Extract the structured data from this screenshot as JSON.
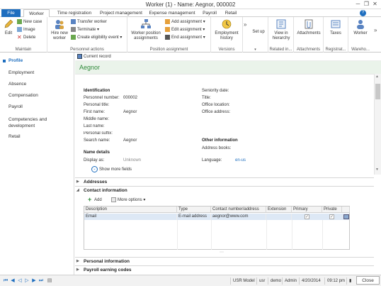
{
  "window": {
    "title": "Worker (1) - Name: Aegnor, 000002",
    "min": "─",
    "restore": "❐",
    "close": "✕"
  },
  "tabs": [
    {
      "label": "File"
    },
    {
      "label": "Worker"
    },
    {
      "label": "Time registration"
    },
    {
      "label": "Project management"
    },
    {
      "label": "Expense management"
    },
    {
      "label": "Payroll"
    },
    {
      "label": "Retail"
    }
  ],
  "ribbon": {
    "maintain": {
      "label": "Maintain",
      "edit": "Edit",
      "new_case": "New case",
      "image": "Image",
      "delete": "Delete"
    },
    "personnel": {
      "label": "Personnel actions",
      "hire": "Hire new worker",
      "transfer": "Transfer worker",
      "terminate": "Terminate",
      "eligibility": "Create eligibility event"
    },
    "position": {
      "label": "Position assignment",
      "worker_position": "Worker position assignments",
      "add": "Add assignment",
      "edit": "Edit assignment",
      "end": "End assignment"
    },
    "versions": {
      "label": "Versions",
      "history": "Employment history"
    },
    "setup": {
      "label": "Set up",
      "more": "»"
    },
    "related": {
      "label": "Related in...",
      "hierarchy": "View in hierarchy"
    },
    "attachments": {
      "label": "Attachments",
      "btn": "Attachments"
    },
    "registration": {
      "label": "Registrat...",
      "taxes": "Taxes"
    },
    "warehouse": {
      "label": "Wareho...",
      "worker": "Worker"
    }
  },
  "nav": {
    "items": [
      "Profile",
      "Employment",
      "Absence",
      "Compensation",
      "Payroll",
      "Competencies and development",
      "Retail"
    ]
  },
  "actionbar": {
    "current_record": "Current record"
  },
  "header": {
    "name": "Aegnor"
  },
  "identification": {
    "title": "Identification",
    "personnel_number_label": "Personnel number:",
    "personnel_number": "000002",
    "personal_title_label": "Personal title:",
    "first_name_label": "First name:",
    "first_name": "Aegnor",
    "middle_name_label": "Middle name:",
    "last_name_label": "Last name:",
    "suffix_label": "Personal suffix:",
    "search_name_label": "Search name:",
    "search_name": "Aegnor"
  },
  "right_col": {
    "seniority_label": "Seniority date:",
    "title_label": "Title:",
    "office_location_label": "Office location:",
    "office_address_label": "Office address:",
    "other_title": "Other information",
    "address_books_label": "Address books:",
    "language_label": "Language:",
    "language": "en-us"
  },
  "name_details": {
    "title": "Name details",
    "display_as_label": "Display as:",
    "display_as": "Unknown",
    "show_more": "Show more fields"
  },
  "fasttabs": {
    "addresses": "Addresses",
    "contact": "Contact information",
    "personal": "Personal information",
    "payroll": "Payroll earning codes"
  },
  "contact_toolbar": {
    "add": "Add",
    "more": "More options"
  },
  "grid": {
    "headers": [
      "Description",
      "Type",
      "Contact number/address",
      "Extension",
      "Primary",
      "Private"
    ],
    "rows": [
      {
        "description": "Email",
        "type": "E-mail address",
        "contact": "aegnor@www.com",
        "extension": ""
      }
    ]
  },
  "statusbar": {
    "model": "USR Model",
    "user": "usr",
    "company": "demo",
    "role": "Admin",
    "date": "4/20/2014",
    "time": "09:12 pm",
    "close": "Close"
  },
  "colors": {
    "accent": "#1e6ebf",
    "header_green": "#2f8a3a",
    "link": "#1e6ebf"
  }
}
